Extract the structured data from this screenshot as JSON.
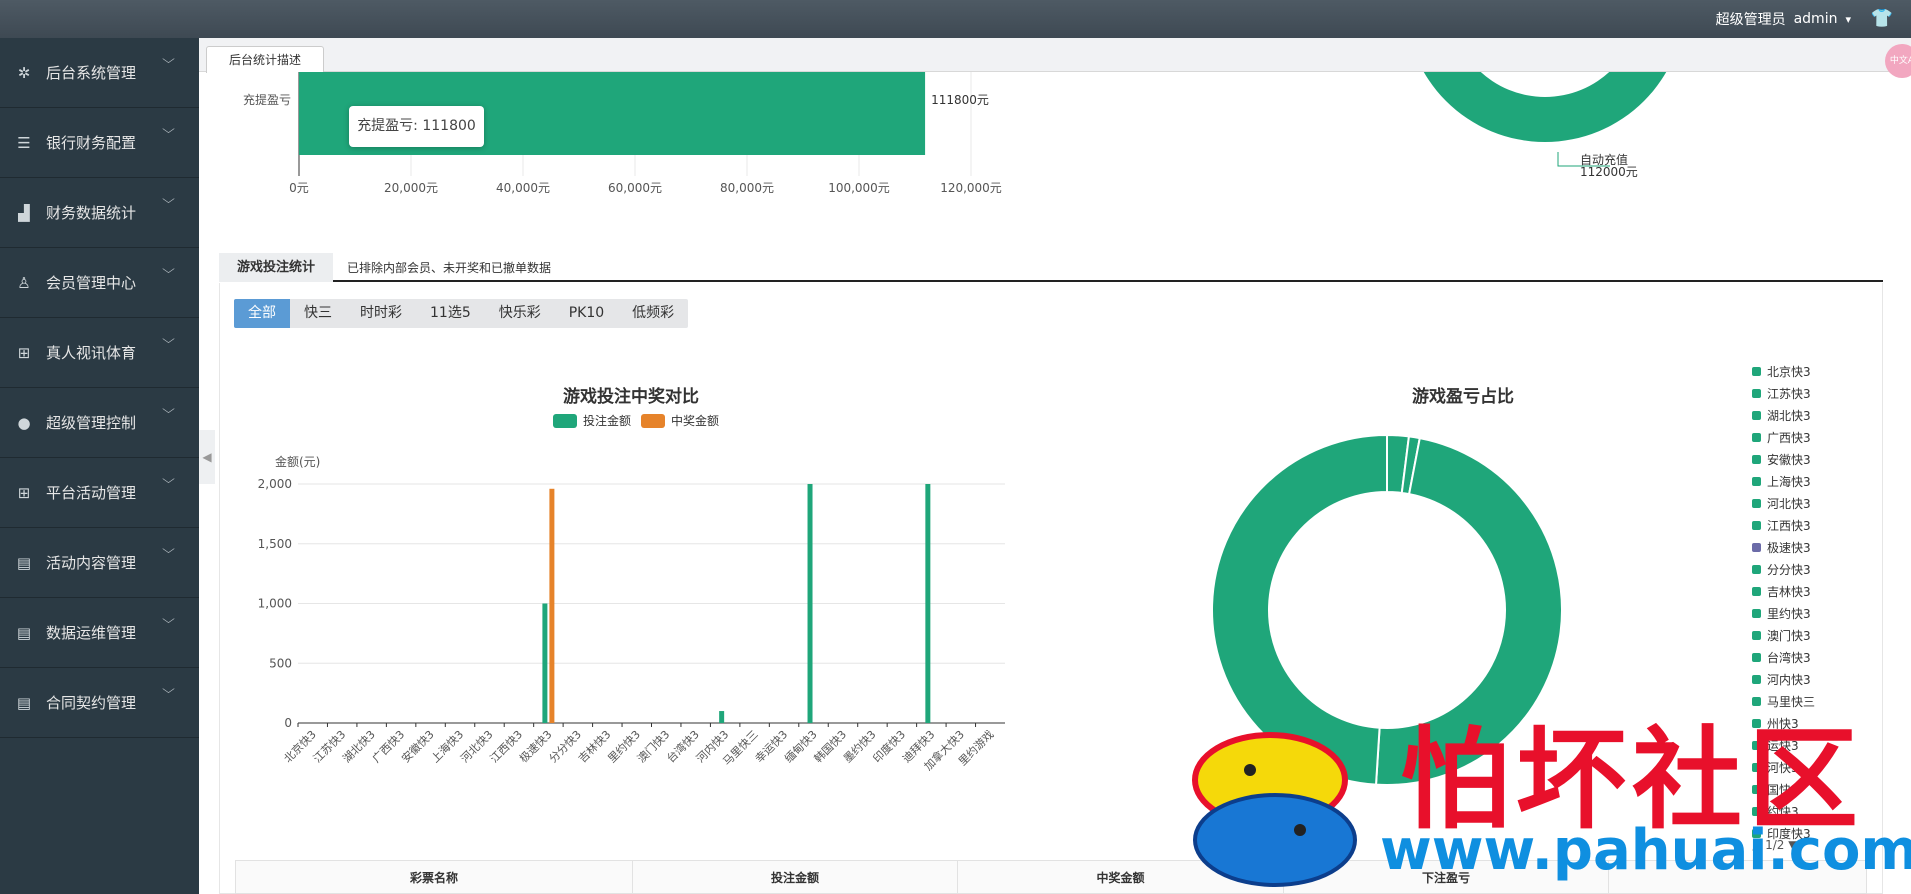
{
  "header": {
    "role": "超级管理员",
    "user": "admin"
  },
  "sidebar": {
    "items": [
      {
        "label": "后台系统管理",
        "icon": "gear-icon",
        "glyph": "✲"
      },
      {
        "label": "银行财务配置",
        "icon": "list-icon",
        "glyph": "☰"
      },
      {
        "label": "财务数据统计",
        "icon": "bar-chart-icon",
        "glyph": "▟"
      },
      {
        "label": "会员管理中心",
        "icon": "user-icon",
        "glyph": "♙"
      },
      {
        "label": "真人视讯体育",
        "icon": "gift-icon",
        "glyph": "⊞"
      },
      {
        "label": "超级管理控制",
        "icon": "person-icon",
        "glyph": "●"
      },
      {
        "label": "平台活动管理",
        "icon": "gift-icon",
        "glyph": "⊞"
      },
      {
        "label": "活动内容管理",
        "icon": "document-icon",
        "glyph": "▤"
      },
      {
        "label": "数据运维管理",
        "icon": "document-icon",
        "glyph": "▤"
      },
      {
        "label": "合同契约管理",
        "icon": "document-icon",
        "glyph": "▤"
      }
    ]
  },
  "tabs": {
    "active": "后台统计描述"
  },
  "badge": {
    "text": "中文A"
  },
  "section": {
    "tab": "游戏投注统计",
    "note": "已排除内部会员、未开奖和已撤单数据"
  },
  "filters": [
    "全部",
    "快三",
    "时时彩",
    "11选5",
    "快乐彩",
    "PK10",
    "低频彩"
  ],
  "table": {
    "headers": [
      "彩票名称",
      "投注金额",
      "中奖金额",
      "下注盈亏"
    ]
  },
  "tooltip": {
    "text": "充提盈亏: 111800"
  },
  "legend": {
    "items": [
      "北京快3",
      "江苏快3",
      "湖北快3",
      "广西快3",
      "安徽快3",
      "上海快3",
      "河北快3",
      "江西快3",
      "极速快3",
      "分分快3",
      "吉林快3",
      "里约快3",
      "澳门快3",
      "台湾快3",
      "河内快3",
      "马里快三",
      "州快3",
      "运快3",
      "河快3",
      "国快3",
      "约快3",
      "印度快3"
    ],
    "colors": [
      "#1fa67a",
      "#1fa67a",
      "#1fa67a",
      "#1fa67a",
      "#1fa67a",
      "#1fa67a",
      "#1fa67a",
      "#1fa67a",
      "#6b6ba8",
      "#1fa67a",
      "#1fa67a",
      "#1fa67a",
      "#1fa67a",
      "#1fa67a",
      "#1fa67a",
      "#1fa67a",
      "#1fa67a",
      "#1fa67a",
      "#1fa67a",
      "#1fa67a",
      "#1fa67a",
      "#1fa67a"
    ],
    "pager": "1/2"
  },
  "watermark": {
    "text1": "怕坏社区",
    "text2": "www.pahuai.com"
  },
  "chart_data": [
    {
      "type": "bar",
      "orientation": "horizontal",
      "categories": [
        "充提盈亏"
      ],
      "values": [
        111800
      ],
      "data_labels": [
        "111800元"
      ],
      "x_ticks": [
        "0元",
        "20,000元",
        "40,000元",
        "60,000元",
        "80,000元",
        "100,000元",
        "120,000元"
      ],
      "xlim": [
        0,
        120000
      ],
      "color": "#1fa67a"
    },
    {
      "type": "pie",
      "style": "donut",
      "labels": [
        "自动充值"
      ],
      "value_labels": [
        "112000元"
      ],
      "color": "#1fa67a"
    },
    {
      "type": "bar",
      "title": "游戏投注中奖对比",
      "ylabel": "金额(元)",
      "ylim": [
        0,
        2000
      ],
      "y_ticks": [
        "0",
        "500",
        "1,000",
        "1,500",
        "2,000"
      ],
      "grid": true,
      "legend_position": "top",
      "categories": [
        "北京快3",
        "江苏快3",
        "湖北快3",
        "广西快3",
        "安徽快3",
        "上海快3",
        "河北快3",
        "江西快3",
        "极速快3",
        "分分快3",
        "吉林快3",
        "里约快3",
        "澳门快3",
        "台湾快3",
        "河内快3",
        "马里快三",
        "幸运快3",
        "缅甸快3",
        "韩国快3",
        "墨约快3",
        "印度快3",
        "迪拜快3",
        "加拿大快3",
        "里约游戏"
      ],
      "series": [
        {
          "name": "投注金额",
          "color": "#1fa67a",
          "values": [
            0,
            0,
            0,
            0,
            0,
            0,
            0,
            0,
            1000,
            0,
            0,
            0,
            0,
            0,
            100,
            0,
            0,
            2000,
            0,
            0,
            0,
            2000,
            0,
            0
          ]
        },
        {
          "name": "中奖金额",
          "color": "#e6832a",
          "values": [
            0,
            0,
            0,
            0,
            0,
            0,
            0,
            0,
            1960,
            0,
            0,
            0,
            0,
            0,
            0,
            0,
            0,
            0,
            0,
            0,
            0,
            0,
            0,
            0
          ]
        }
      ]
    },
    {
      "type": "pie",
      "style": "donut",
      "title": "游戏盈亏占比",
      "slices": [
        {
          "label": "极速快3",
          "value": 2,
          "color": "#1fa67a"
        },
        {
          "label": "河内快3",
          "value": 1,
          "color": "#1fa67a"
        },
        {
          "label": "缅甸快3",
          "value": 48,
          "color": "#1fa67a"
        },
        {
          "label": "迪拜快3",
          "value": 49,
          "color": "#1fa67a"
        }
      ]
    }
  ]
}
